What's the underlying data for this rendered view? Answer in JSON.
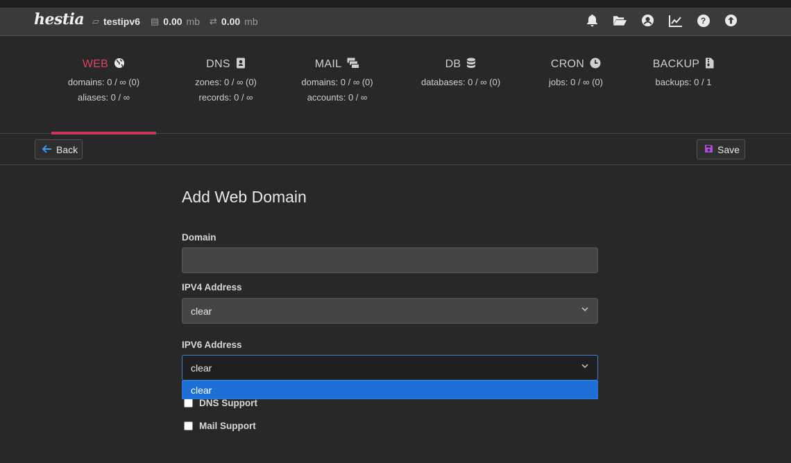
{
  "topbar": {
    "logo": "hestia",
    "user": "testipv6",
    "disk_value": "0.00",
    "disk_unit": "mb",
    "bandwidth_value": "0.00",
    "bandwidth_unit": "mb",
    "icons": [
      "bell-icon",
      "folder-open-icon",
      "user-circle-icon",
      "chart-line-icon",
      "help-icon",
      "upgrade-arrow-icon"
    ]
  },
  "tabs": [
    {
      "title": "WEB",
      "line1": "domains: 0 / ∞ (0)",
      "line2": "aliases: 0 / ∞",
      "active": true,
      "icon": "globe-icon"
    },
    {
      "title": "DNS",
      "line1": "zones: 0 / ∞ (0)",
      "line2": "records: 0 / ∞",
      "active": false,
      "icon": "address-book-icon"
    },
    {
      "title": "MAIL",
      "line1": "domains: 0 / ∞ (0)",
      "line2": "accounts: 0 / ∞",
      "active": false,
      "icon": "mail-bulk-icon"
    },
    {
      "title": "DB",
      "line1": "databases: 0 / ∞ (0)",
      "line2": "",
      "active": false,
      "icon": "database-icon"
    },
    {
      "title": "CRON",
      "line1": "jobs: 0 / ∞ (0)",
      "line2": "",
      "active": false,
      "icon": "clock-icon"
    },
    {
      "title": "BACKUP",
      "line1": "backups: 0 / 1",
      "line2": "",
      "active": false,
      "icon": "file-archive-icon"
    }
  ],
  "toolbar": {
    "back_label": "Back",
    "save_label": "Save"
  },
  "form": {
    "heading": "Add Web Domain",
    "domain_label": "Domain",
    "domain_value": "",
    "ipv4_label": "IPV4 Address",
    "ipv4_value": "clear",
    "ipv6_label": "IPV6 Address",
    "ipv6_value": "clear",
    "ipv6_options": [
      "clear"
    ],
    "dns_support_label": "DNS Support",
    "mail_support_label": "Mail Support"
  },
  "colors": {
    "accent": "#c9375a",
    "active_tab_text": "#e0435d",
    "focus_border": "#3b82d6",
    "dropdown_highlight": "#1d6fd6",
    "save_icon": "#b04be0",
    "back_icon": "#3b9cf0"
  }
}
